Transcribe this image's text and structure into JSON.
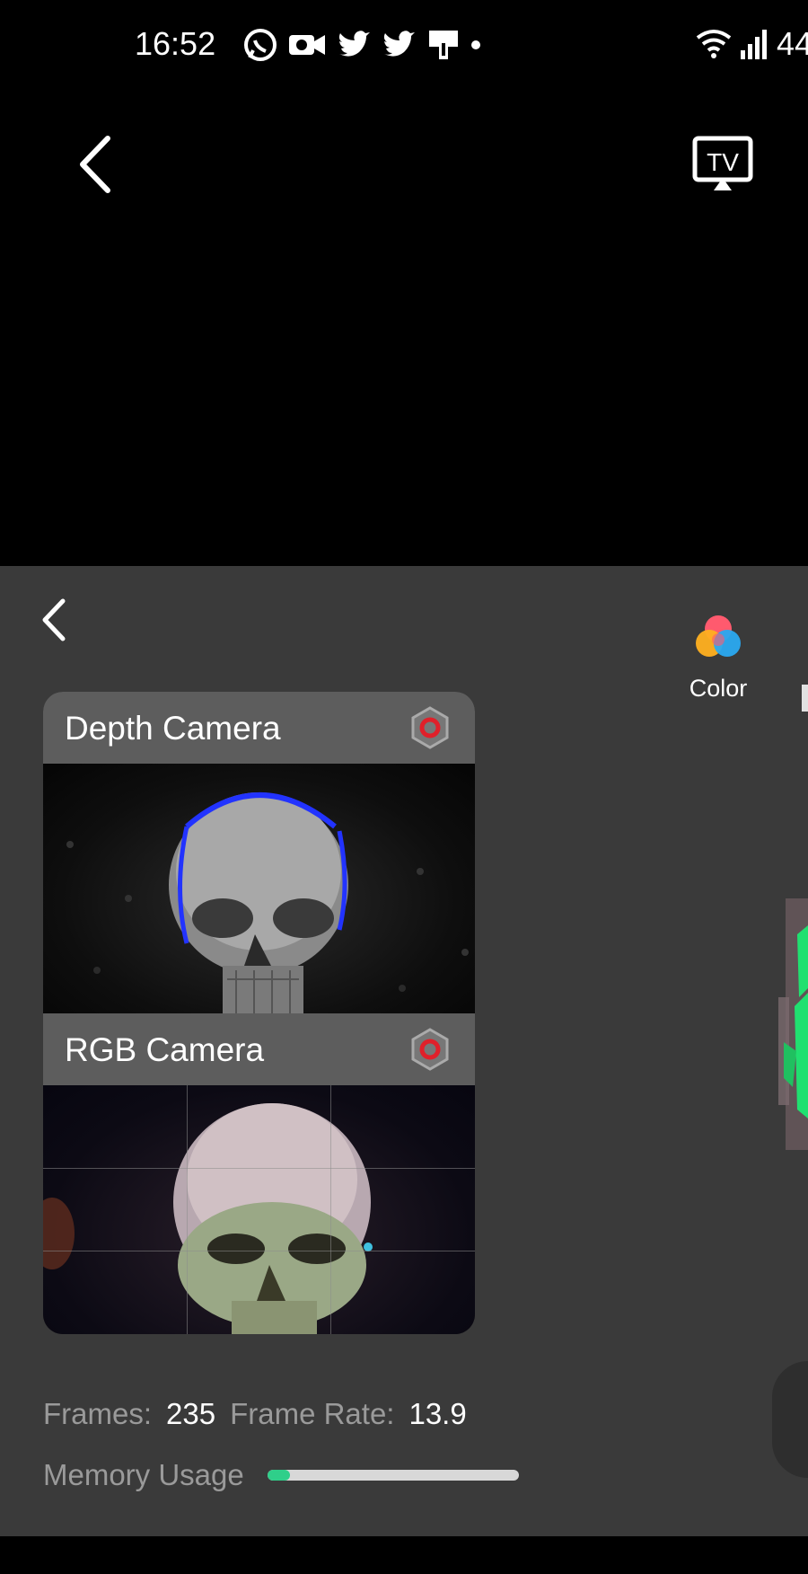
{
  "status_bar": {
    "time": "16:52",
    "battery_text": "44"
  },
  "panel": {
    "mode_color_label": "Color"
  },
  "cameras": [
    {
      "title": "Depth Camera"
    },
    {
      "title": "RGB Camera"
    }
  ],
  "stats": {
    "frames_label": "Frames:",
    "frames_value": "235",
    "frame_rate_label": "Frame Rate:",
    "frame_rate_value": "13.9"
  },
  "memory": {
    "label": "Memory Usage",
    "usage_fraction": 0.09
  },
  "colors": {
    "panel_bg": "#3a3a3a",
    "accent_green": "#2fcf8a",
    "record_red": "#e0202a"
  }
}
